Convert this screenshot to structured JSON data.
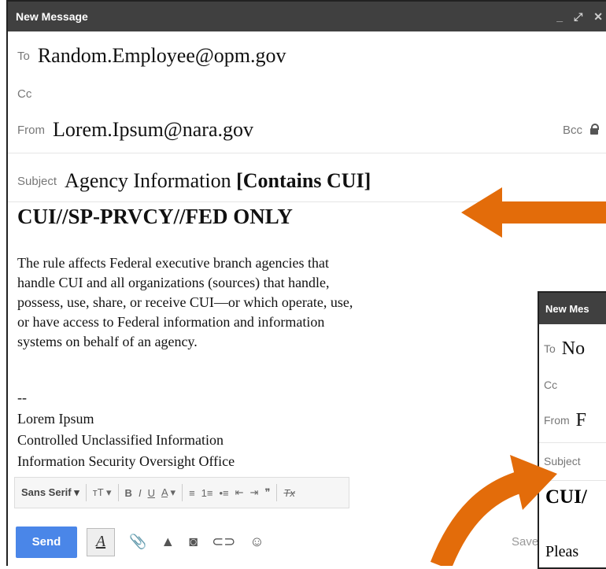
{
  "window": {
    "title": "New Message",
    "controls": {
      "minimize": "_",
      "expand": "⤢",
      "close": "✕"
    }
  },
  "fields": {
    "to_label": "To",
    "to_value": "Random.Employee@opm.gov",
    "cc_label": "Cc",
    "from_label": "From",
    "from_value": "Lorem.Ipsum@nara.gov",
    "bcc_label": "Bcc",
    "subject_label": "Subject",
    "subject_value": "Agency Information ",
    "subject_marker": "[Contains CUI]"
  },
  "message": {
    "banner": "CUI//SP-PRVCY//FED ONLY",
    "body_lines": [
      "The rule affects Federal executive branch agencies that",
      "handle CUI and all organizations (sources) that handle,",
      "possess, use, share, or receive CUI—or which operate, use,",
      "or have access to Federal information and information",
      "systems on behalf of an agency."
    ],
    "signature": [
      "--",
      "Lorem Ipsum",
      "Controlled Unclassified Information",
      "Information Security Oversight Office"
    ]
  },
  "format_toolbar": {
    "font": "Sans Serif",
    "size_icon": "text-size-icon",
    "items": [
      "B",
      "I",
      "U",
      "A",
      "≡",
      "1≡",
      "•≡",
      "⇤",
      "⇥",
      "❞",
      "Tx"
    ]
  },
  "actions": {
    "send": "Send",
    "saved": "Saved"
  },
  "second_window": {
    "title": "New Mes",
    "to_label": "To",
    "to_value": "No",
    "cc_label": "Cc",
    "from_label": "From",
    "from_value": "F",
    "subject_label": "Subject",
    "subject_value": "",
    "banner": "CUI/",
    "body": "Pleas"
  },
  "colors": {
    "arrow": "#e36c0a",
    "titlebar": "#404040",
    "send": "#4a86e8"
  }
}
